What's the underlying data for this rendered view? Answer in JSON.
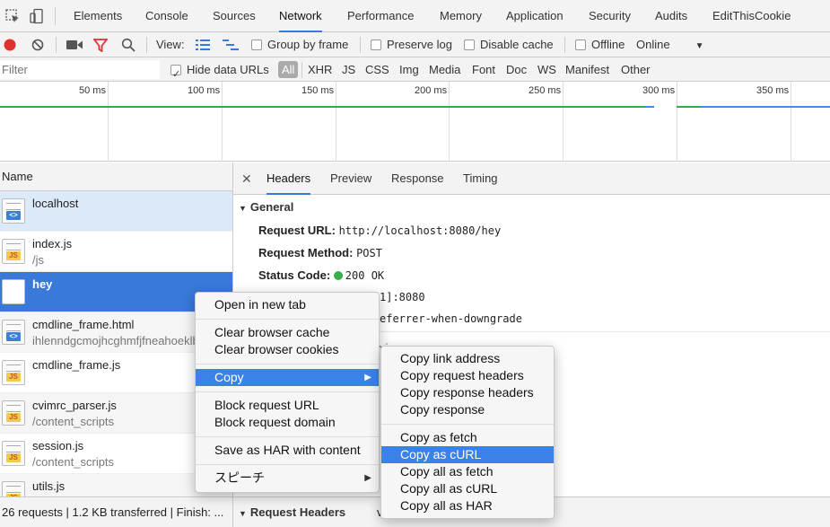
{
  "tabs": [
    "Elements",
    "Console",
    "Sources",
    "Network",
    "Performance",
    "Memory",
    "Application",
    "Security",
    "Audits",
    "EditThisCookie"
  ],
  "active_tab": "Network",
  "toolbar": {
    "view_label": "View:",
    "group_by_frame": "Group by frame",
    "preserve_log": "Preserve log",
    "disable_cache": "Disable cache",
    "offline": "Offline",
    "throttle": "Online"
  },
  "filter": {
    "placeholder": "Filter",
    "hide_data_urls": "Hide data URLs",
    "types": [
      "All",
      "XHR",
      "JS",
      "CSS",
      "Img",
      "Media",
      "Font",
      "Doc",
      "WS",
      "Manifest",
      "Other"
    ]
  },
  "timeline": {
    "ticks": [
      "50 ms",
      "100 ms",
      "150 ms",
      "200 ms",
      "250 ms",
      "300 ms",
      "350 ms"
    ]
  },
  "requests": {
    "header": "Name",
    "rows": [
      {
        "name": "localhost",
        "path": "",
        "type": "html"
      },
      {
        "name": "index.js",
        "path": "/js",
        "type": "js"
      },
      {
        "name": "hey",
        "path": "",
        "type": "blank"
      },
      {
        "name": "cmdline_frame.html",
        "path": "ihlenndgcmojhcghmfjfneahoeklbjjh",
        "type": "html"
      },
      {
        "name": "cmdline_frame.js",
        "path": "",
        "type": "js"
      },
      {
        "name": "cvimrc_parser.js",
        "path": "/content_scripts",
        "type": "js"
      },
      {
        "name": "session.js",
        "path": "/content_scripts",
        "type": "js"
      },
      {
        "name": "utils.js",
        "path": "",
        "type": "js"
      }
    ],
    "status": "26 requests | 1.2 KB transferred | Finish: ..."
  },
  "detail": {
    "tabs": [
      "Headers",
      "Preview",
      "Response",
      "Timing"
    ],
    "active_tab": "Headers",
    "general_title": "General",
    "request_url_label": "Request URL:",
    "request_url": "http://localhost:8080/hey",
    "request_method_label": "Request Method:",
    "request_method": "POST",
    "status_code_label": "Status Code:",
    "status_code": "200 OK",
    "remote_address_fragment": "1]:8080",
    "referrer_policy_fragment": "eferrer-when-downgrade",
    "view_source_fragment": "view source",
    "request_headers_title": "Request Headers",
    "request_headers_fragment": "v"
  },
  "context_menu": {
    "items": [
      "Open in new tab",
      "Clear browser cache",
      "Clear browser cookies",
      "Copy",
      "Block request URL",
      "Block request domain",
      "Save as HAR with content",
      "スピーチ"
    ]
  },
  "copy_submenu": {
    "items": [
      "Copy link address",
      "Copy request headers",
      "Copy response headers",
      "Copy response",
      "Copy as fetch",
      "Copy as cURL",
      "Copy all as fetch",
      "Copy all as cURL",
      "Copy all as HAR"
    ]
  }
}
